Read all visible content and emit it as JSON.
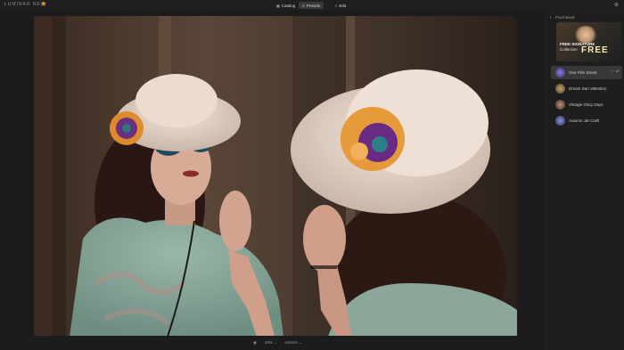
{
  "app": {
    "logo_text": "LUMINAR NEO"
  },
  "nav": {
    "catalog": "Catalog",
    "presets": "Presets",
    "edit": "Edit"
  },
  "bottom": {
    "zoom": "33%",
    "actions": "Actions"
  },
  "panel": {
    "title": "Purchased",
    "banner": {
      "line1": "FREE SIGNATURE",
      "line2": "Collection",
      "line3": "FREE"
    },
    "items": [
      {
        "label": "One Film Street",
        "selected": true
      },
      {
        "label": "Dream Sari Valentino",
        "selected": false
      },
      {
        "label": "Vintage Glory Days",
        "selected": false
      },
      {
        "label": "Autumn Jar Craft",
        "selected": false
      }
    ]
  },
  "colors": {
    "background": "#1b1b1c",
    "panel": "#1e1e1f",
    "selected_row": "#38383a",
    "active_tab": "#3a3a3b"
  }
}
